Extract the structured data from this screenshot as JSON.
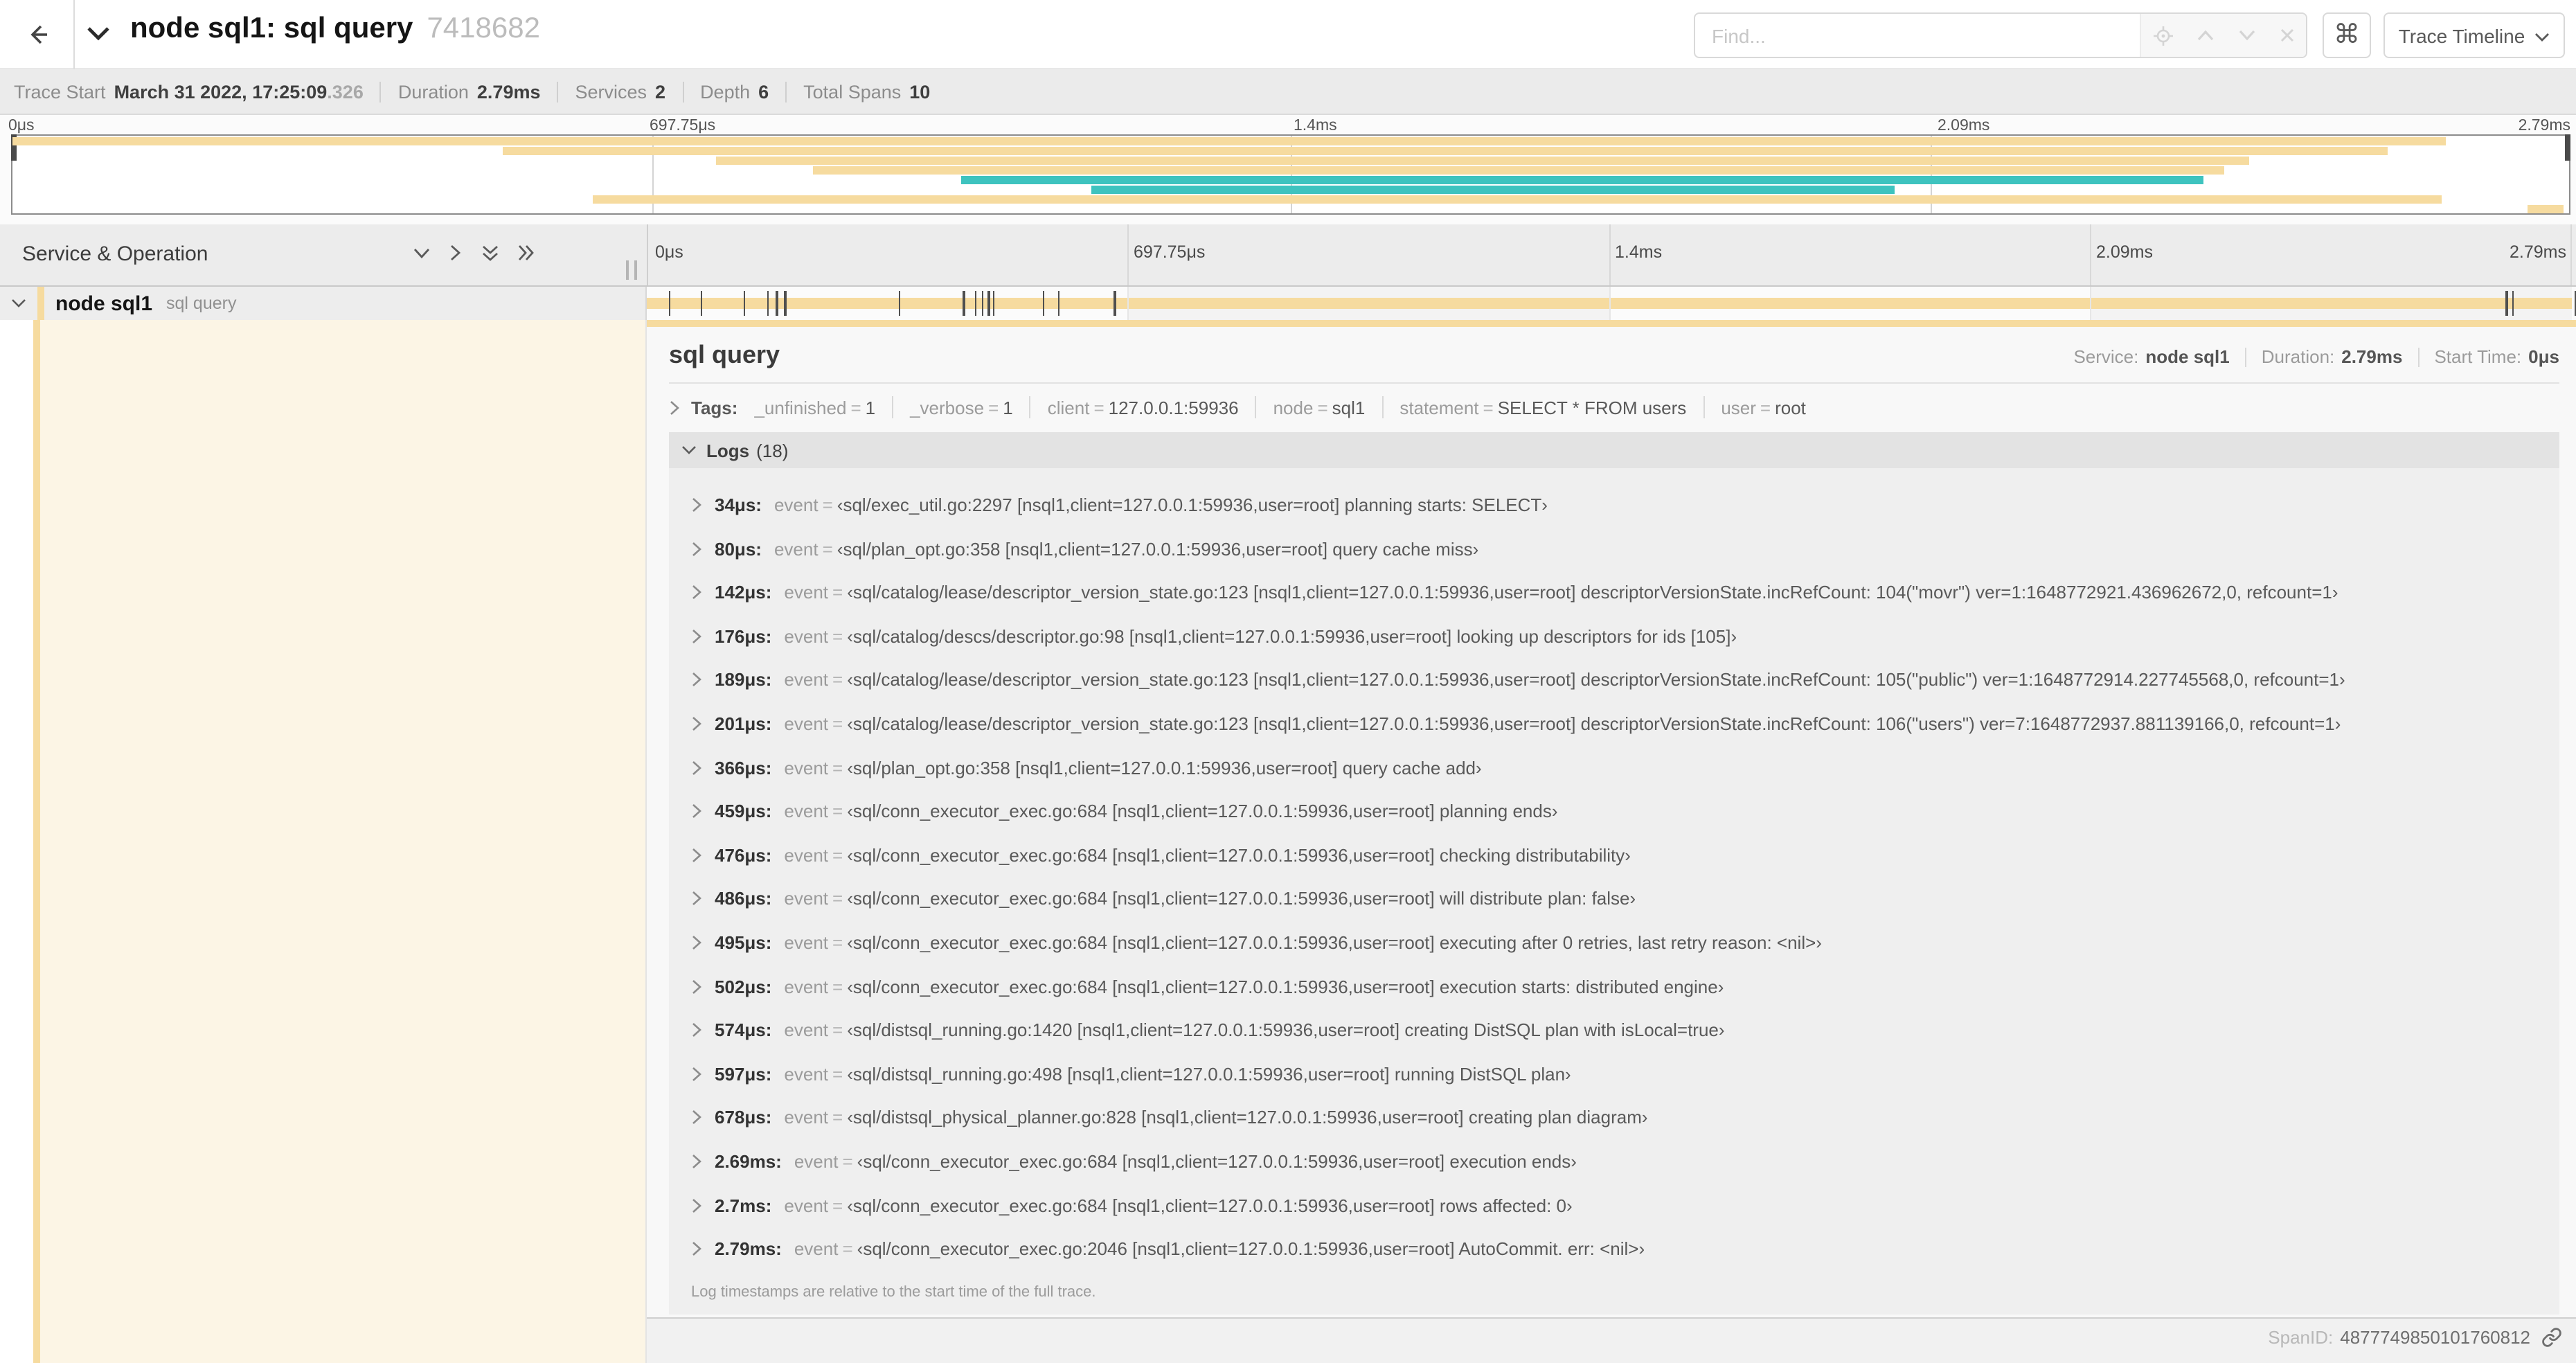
{
  "colors": {
    "tan": "#F6DB9F",
    "teal": "#3EC3BF",
    "tick": "#4F4F4F"
  },
  "header": {
    "back_icon": "back-arrow",
    "title": "node sql1: sql query",
    "trace_id": "7418682",
    "find_placeholder": "Find...",
    "shortcut_label": "⌘",
    "view_selector_label": "Trace Timeline"
  },
  "trace_info": {
    "items": [
      {
        "label": "Trace Start",
        "value": "March 31 2022, 17:25:09",
        "suffix": ".326"
      },
      {
        "label": "Duration",
        "value": "2.79ms"
      },
      {
        "label": "Services",
        "value": "2"
      },
      {
        "label": "Depth",
        "value": "6"
      },
      {
        "label": "Total Spans",
        "value": "10"
      }
    ]
  },
  "timeline": {
    "tick_labels": [
      "0μs",
      "697.75μs",
      "1.4ms",
      "2.09ms",
      "2.79ms"
    ],
    "header_label": "Service & Operation"
  },
  "minimap": {
    "bars": [
      {
        "start": 0.0,
        "end": 0.952,
        "color": "tan"
      },
      {
        "start": 0.192,
        "end": 0.929,
        "color": "tan"
      },
      {
        "start": 0.275,
        "end": 0.875,
        "color": "tan"
      },
      {
        "start": 0.313,
        "end": 0.865,
        "color": "tan"
      },
      {
        "start": 0.371,
        "end": 0.857,
        "color": "teal"
      },
      {
        "start": 0.422,
        "end": 0.736,
        "color": "teal"
      },
      {
        "start": 0.227,
        "end": 0.95,
        "color": "tan"
      },
      {
        "start": 0.984,
        "end": 0.998,
        "color": "tan"
      }
    ]
  },
  "span_row": {
    "service": "node sql1",
    "operation": "sql query"
  },
  "detail": {
    "title": "sql query",
    "meta": [
      {
        "label": "Service:",
        "value": "node sql1"
      },
      {
        "label": "Duration:",
        "value": "2.79ms"
      },
      {
        "label": "Start Time:",
        "value": "0μs"
      }
    ],
    "tags_label": "Tags:",
    "tags": [
      {
        "key": "_unfinished",
        "value": "1"
      },
      {
        "key": "_verbose",
        "value": "1"
      },
      {
        "key": "client",
        "value": "127.0.0.1:59936"
      },
      {
        "key": "node",
        "value": "sql1"
      },
      {
        "key": "statement",
        "value": "SELECT * FROM users"
      },
      {
        "key": "user",
        "value": "root"
      }
    ],
    "logs_label": "Logs",
    "logs_count": "(18)",
    "logs": [
      {
        "time": "34μs:",
        "frac": 0.0122,
        "key": "event",
        "value": "‹sql/exec_util.go:2297 [nsql1,client=127.0.0.1:59936,user=root] planning starts: SELECT›"
      },
      {
        "time": "80μs:",
        "frac": 0.0287,
        "key": "event",
        "value": "‹sql/plan_opt.go:358 [nsql1,client=127.0.0.1:59936,user=root] query cache miss›"
      },
      {
        "time": "142μs:",
        "frac": 0.0509,
        "key": "event",
        "value": "‹sql/catalog/lease/descriptor_version_state.go:123 [nsql1,client=127.0.0.1:59936,user=root] descriptorVersionState.incRefCount: 104(\"movr\") ver=1:1648772921.436962672,0, refcount=1›"
      },
      {
        "time": "176μs:",
        "frac": 0.0631,
        "key": "event",
        "value": "‹sql/catalog/descs/descriptor.go:98 [nsql1,client=127.0.0.1:59936,user=root] looking up descriptors for ids [105]›"
      },
      {
        "time": "189μs:",
        "frac": 0.0677,
        "key": "event",
        "value": "‹sql/catalog/lease/descriptor_version_state.go:123 [nsql1,client=127.0.0.1:59936,user=root] descriptorVersionState.incRefCount: 105(\"public\") ver=1:1648772914.227745568,0, refcount=1›"
      },
      {
        "time": "201μs:",
        "frac": 0.072,
        "key": "event",
        "value": "‹sql/catalog/lease/descriptor_version_state.go:123 [nsql1,client=127.0.0.1:59936,user=root] descriptorVersionState.incRefCount: 106(\"users\") ver=7:1648772937.881139166,0, refcount=1›"
      },
      {
        "time": "366μs:",
        "frac": 0.1312,
        "key": "event",
        "value": "‹sql/plan_opt.go:358 [nsql1,client=127.0.0.1:59936,user=root] query cache add›"
      },
      {
        "time": "459μs:",
        "frac": 0.1645,
        "key": "event",
        "value": "‹sql/conn_executor_exec.go:684 [nsql1,client=127.0.0.1:59936,user=root] planning ends›"
      },
      {
        "time": "476μs:",
        "frac": 0.1706,
        "key": "event",
        "value": "‹sql/conn_executor_exec.go:684 [nsql1,client=127.0.0.1:59936,user=root] checking distributability›"
      },
      {
        "time": "486μs:",
        "frac": 0.1742,
        "key": "event",
        "value": "‹sql/conn_executor_exec.go:684 [nsql1,client=127.0.0.1:59936,user=root] will distribute plan: false›"
      },
      {
        "time": "495μs:",
        "frac": 0.1774,
        "key": "event",
        "value": "‹sql/conn_executor_exec.go:684 [nsql1,client=127.0.0.1:59936,user=root] executing after 0 retries, last retry reason: <nil>›"
      },
      {
        "time": "502μs:",
        "frac": 0.1799,
        "key": "event",
        "value": "‹sql/conn_executor_exec.go:684 [nsql1,client=127.0.0.1:59936,user=root] execution starts: distributed engine›"
      },
      {
        "time": "574μs:",
        "frac": 0.2057,
        "key": "event",
        "value": "‹sql/distsql_running.go:1420 [nsql1,client=127.0.0.1:59936,user=root] creating DistSQL plan with isLocal=true›"
      },
      {
        "time": "597μs:",
        "frac": 0.214,
        "key": "event",
        "value": "‹sql/distsql_running.go:498 [nsql1,client=127.0.0.1:59936,user=root] running DistSQL plan›"
      },
      {
        "time": "678μs:",
        "frac": 0.243,
        "key": "event",
        "value": "‹sql/distsql_physical_planner.go:828 [nsql1,client=127.0.0.1:59936,user=root] creating plan diagram›"
      },
      {
        "time": "2.69ms:",
        "frac": 0.9642,
        "key": "event",
        "value": "‹sql/conn_executor_exec.go:684 [nsql1,client=127.0.0.1:59936,user=root] execution ends›"
      },
      {
        "time": "2.7ms:",
        "frac": 0.9677,
        "key": "event",
        "value": "‹sql/conn_executor_exec.go:684 [nsql1,client=127.0.0.1:59936,user=root] rows affected: 0›"
      },
      {
        "time": "2.79ms:",
        "frac": 1.0,
        "key": "event",
        "value": "‹sql/conn_executor_exec.go:2046 [nsql1,client=127.0.0.1:59936,user=root] AutoCommit. err: <nil>›"
      }
    ],
    "logs_note": "Log timestamps are relative to the start time of the full trace.",
    "spanid_label": "SpanID:",
    "spanid_value": "4877749850101760812"
  }
}
